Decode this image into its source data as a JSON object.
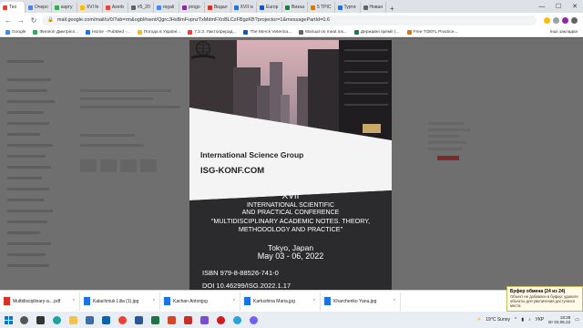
{
  "tabs": [
    {
      "label": "Тео",
      "color": "#ea4335",
      "active": true
    },
    {
      "label": "Очеро",
      "color": "#4285f4"
    },
    {
      "label": "карту",
      "color": "#34a853"
    },
    {
      "label": "ХVI fo",
      "color": "#fbbc05"
    },
    {
      "label": "Azerb",
      "color": "#ea4335"
    },
    {
      "label": "#5_20",
      "color": "#5f6368"
    },
    {
      "label": "regali",
      "color": "#4285f4"
    },
    {
      "label": "progo",
      "color": "#8e24aa"
    },
    {
      "label": "Видал",
      "color": "#d93025"
    },
    {
      "label": "XVII is",
      "color": "#1a73e8"
    },
    {
      "label": "Europ",
      "color": "#0b57d0"
    },
    {
      "label": "Визна",
      "color": "#188038"
    },
    {
      "label": "5 TPIC",
      "color": "#e37400"
    },
    {
      "label": "Турти",
      "color": "#1a73e8"
    },
    {
      "label": "Новая",
      "color": "#5f6368"
    }
  ],
  "address": {
    "url": "mail.google.com/mail/u/0/?ab=rm&ogbl#sent/QgrcJHsBmFvpnzTxMdmFXnBLCzFBgzKB?projector=1&messagePartId=0.6"
  },
  "bookmarks": [
    {
      "label": "Google",
      "color": "#4285f4"
    },
    {
      "label": "Филеоп Дмитрієп...",
      "color": "#34a853"
    },
    {
      "label": "Home - PubMed -...",
      "color": "#1a73e8"
    },
    {
      "label": "Погода в Україні...",
      "color": "#fbbc05"
    },
    {
      "label": "7.2.3. Лактопрерад...",
      "color": "#ea4335"
    },
    {
      "label": "The Merck Veterina...",
      "color": "#0b57d0"
    },
    {
      "label": "Manual on meat ins...",
      "color": "#5f6368"
    },
    {
      "label": "Державні премії (...",
      "color": "#188038"
    },
    {
      "label": "Free TOEFL Practice...",
      "color": "#e37400"
    }
  ],
  "bookmarks_other": "Інші закладки",
  "preview": {
    "cover": {
      "org_name": "International Science Group",
      "org_url": "ISG-KONF.COM",
      "roman": "XVII",
      "line1": "INTERNATIONAL SCIENTIFIC",
      "line2": "AND PRACTICAL CONFERENCE",
      "line3": "\"MULTIDISCIPLINARY ACADEMIC NOTES. THEORY, METHODOLOGY AND PRACTICE\"",
      "city": "Tokyo, Japan",
      "dates": "May 03 - 06, 2022",
      "isbn": "ISBN  979-8-88526-741-0",
      "doi": "DOI  10.46299/ISG.2022.1.17"
    }
  },
  "downloads": [
    {
      "name": "Multidisciplinary-a....pdf",
      "color": "#d93025"
    },
    {
      "name": "Kalachniuk Lilia (1).jpg",
      "color": "#1a73e8"
    },
    {
      "name": "Kachan Antonjpg",
      "color": "#1a73e8"
    },
    {
      "name": "Kartushina Maria.jpg",
      "color": "#1a73e8"
    },
    {
      "name": "Kharchenko Yana.jpg",
      "color": "#1a73e8"
    }
  ],
  "notification": {
    "title": "Буфер обмена (24 из 24)",
    "body": "Объект не добавлен в буфер: удалите объекты для увеличения доступного места"
  },
  "taskbar": {
    "weather": "19°C  Sunny",
    "lang": "УКР",
    "time": "18:38",
    "date": "Вт 03.05.22"
  }
}
